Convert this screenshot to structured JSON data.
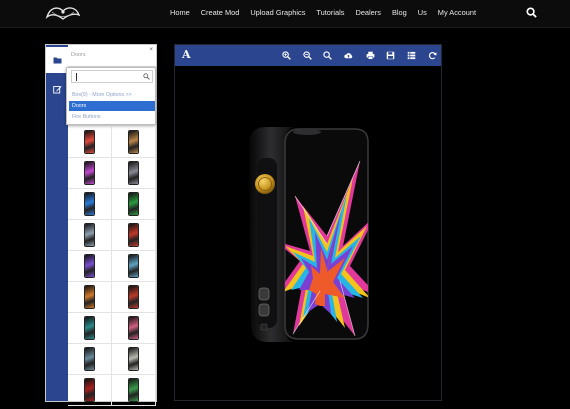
{
  "nav": {
    "logo_icon": "logo-emblem",
    "links": [
      "Home",
      "Create Mod",
      "Upload Graphics",
      "Tutorials",
      "Dealers",
      "Blog",
      "Us",
      "My Account"
    ],
    "search_icon": "search-icon"
  },
  "left_panel": {
    "rail_icons": [
      "folder-icon",
      "edit-icon"
    ],
    "selected_category": "Doors",
    "close_glyph": "×",
    "dropdown": {
      "search_value": "",
      "options": [
        "Box(9) - More Options >>",
        "Doors",
        "Fire Buttons"
      ],
      "selected_index": 1
    },
    "thumbnails": [
      {
        "col1": "#e14b3c",
        "col2": "#b9864a"
      },
      {
        "col1": "#c24ad0",
        "col2": "#8a8a96"
      },
      {
        "col1": "#2a7ad8",
        "col2": "#2b9a3f"
      },
      {
        "col1": "#8da0b0",
        "col2": "#c0392b"
      },
      {
        "col1": "#7a4fd0",
        "col2": "#5fa0c0"
      },
      {
        "col1": "#d07a2a",
        "col2": "#b83a2a"
      },
      {
        "col1": "#2c8a8a",
        "col2": "#d05f80"
      },
      {
        "col1": "#6a8a9a",
        "col2": "#b8b8b0"
      },
      {
        "col1": "#a82020",
        "col2": "#3a9a4a"
      }
    ]
  },
  "viewer": {
    "text_tool_label": "A",
    "toolbar_icons": [
      "zoom-in-icon",
      "zoom-out-icon",
      "zoom-reset-icon",
      "cloud-upload-icon",
      "print-icon",
      "save-icon",
      "list-icon",
      "refresh-icon"
    ],
    "colors": {
      "bar": "#2b468f",
      "body": "#1a1a1a",
      "button_gold": "#c8961e"
    }
  }
}
